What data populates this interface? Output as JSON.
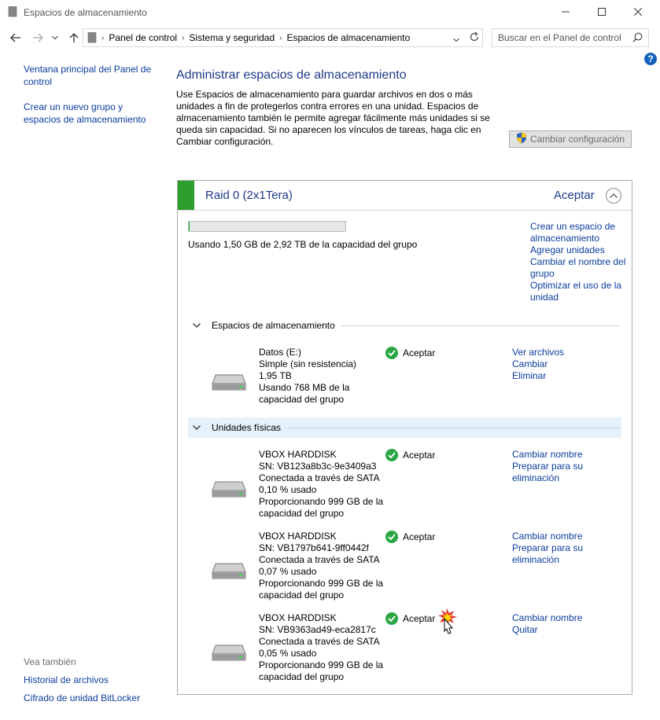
{
  "window": {
    "title": "Espacios de almacenamiento"
  },
  "address": {
    "crumbs": [
      "Panel de control",
      "Sistema y seguridad",
      "Espacios de almacenamiento"
    ],
    "search_placeholder": "Buscar en el Panel de control"
  },
  "sidebar": {
    "links": [
      "Ventana principal del Panel de control",
      "Crear un nuevo grupo y espacios de almacenamiento"
    ],
    "see_also_title": "Vea también",
    "see_also": [
      "Historial de archivos",
      "Cifrado de unidad BitLocker"
    ]
  },
  "main": {
    "title": "Administrar espacios de almacenamiento",
    "intro": "Use Espacios de almacenamiento para guardar archivos en dos o más unidades a fin de protegerlos contra errores en una unidad. Espacios de almacenamiento también le permite agregar fácilmente más unidades si se queda sin capacidad. Si no aparecen los vínculos de tareas, haga clic en Cambiar configuración.",
    "change_settings_label": "Cambiar configuración"
  },
  "pool": {
    "name": "Raid 0 (2x1Tera)",
    "status": "Aceptar",
    "usage_fraction": 0.0005,
    "usage_text": "Usando 1,50 GB de 2,92 TB de la capacidad del grupo",
    "links": [
      "Crear un espacio de almacenamiento",
      "Agregar unidades",
      "Cambiar el nombre del grupo",
      "Optimizar el uso de la unidad"
    ],
    "spaces_section_label": "Espacios de almacenamiento",
    "spaces": [
      {
        "name": "Datos (E:)",
        "resiliency": "Simple (sin resistencia)",
        "size": "1,95 TB",
        "usage": "Usando 768 MB de la capacidad del grupo",
        "status": "Aceptar",
        "links": [
          "Ver archivos",
          "Cambiar",
          "Eliminar"
        ]
      }
    ],
    "physical_section_label": "Unidades físicas",
    "physical": [
      {
        "name": "VBOX HARDDISK",
        "serial": "SN: VB123a8b3c-9e3409a3",
        "connection": "Conectada a través de SATA",
        "used": "0,10 % usado",
        "provides": "Proporcionando 999 GB de la capacidad del grupo",
        "status": "Aceptar",
        "links": [
          "Cambiar nombre",
          "Preparar para su eliminación"
        ]
      },
      {
        "name": "VBOX HARDDISK",
        "serial": "SN: VB1797b641-9ff0442f",
        "connection": "Conectada a través de SATA",
        "used": "0,07 % usado",
        "provides": "Proporcionando 999 GB de la capacidad del grupo",
        "status": "Aceptar",
        "links": [
          "Cambiar nombre",
          "Preparar para su eliminación"
        ]
      },
      {
        "name": "VBOX HARDDISK",
        "serial": "SN: VB9363ad49-eca2817c",
        "connection": "Conectada a través de SATA",
        "used": "0,05 % usado",
        "provides": "Proporcionando 999 GB de la capacidad del grupo",
        "status": "Aceptar",
        "links": [
          "Cambiar nombre",
          "Quitar"
        ]
      }
    ]
  },
  "colors": {
    "link": "#0b3c9c",
    "title": "#1e3a8a",
    "ok": "#2aa744",
    "pool_bar": "#2c9e2c"
  }
}
